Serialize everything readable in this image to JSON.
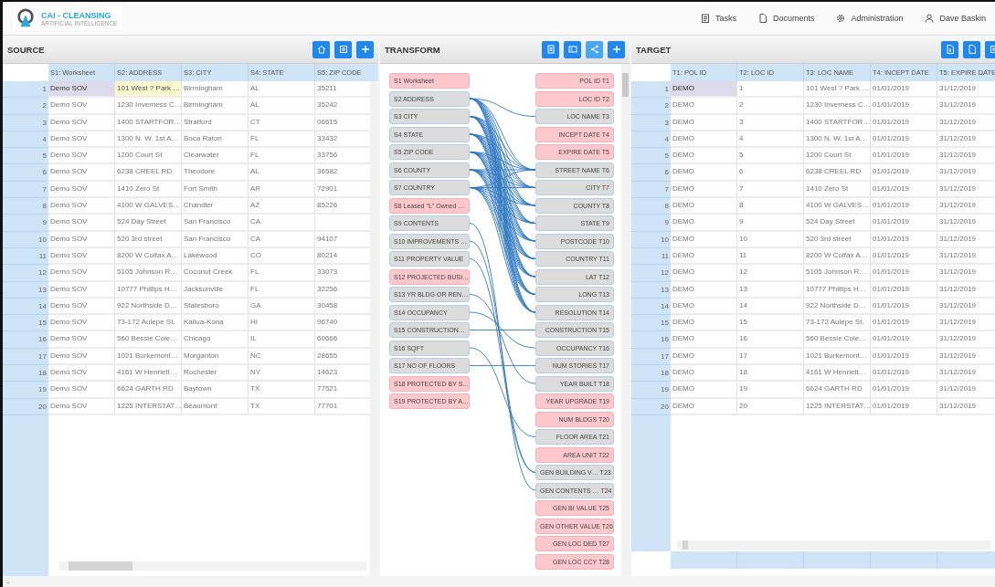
{
  "app": {
    "logo_title": "CAI - CLEANSING",
    "logo_subtitle": "ARTIFICIAL INTELLIGENCE"
  },
  "nav": [
    {
      "label": "Tasks",
      "kind": "tasks"
    },
    {
      "label": "Documents",
      "kind": "documents"
    },
    {
      "label": "Administration",
      "kind": "admin"
    },
    {
      "label": "Dave Baskin",
      "kind": "user"
    }
  ],
  "source": {
    "title": "SOURCE",
    "columns": [
      "S1: Worksheet",
      "S2: ADDRESS",
      "S3: CITY",
      "S4: STATE",
      "S5: ZIP CODE"
    ],
    "rows": [
      {
        "num": "1",
        "cells": [
          "Demo SOV",
          "101 West ? Park …",
          "Birmingham",
          "AL",
          "35211"
        ],
        "selected": true,
        "flagged": true
      },
      {
        "num": "2",
        "cells": [
          "Demo SOV",
          "1230 Inverness C…",
          "Birmingham",
          "AL",
          "35242"
        ],
        "selected": false,
        "flagged": false
      },
      {
        "num": "3",
        "cells": [
          "Demo SOV",
          "1400 STARTFOR…",
          "Stratford",
          "CT",
          "06615"
        ],
        "selected": false,
        "flagged": false
      },
      {
        "num": "4",
        "cells": [
          "Demo SOV",
          "1300 N. W. 1st A…",
          "Boca Raton",
          "FL",
          "33432"
        ],
        "selected": false,
        "flagged": false
      },
      {
        "num": "5",
        "cells": [
          "Demo SOV",
          "1200 Court St",
          "Clearwater",
          "FL",
          "33756"
        ],
        "selected": false,
        "flagged": false
      },
      {
        "num": "6",
        "cells": [
          "Demo SOV",
          "6238 CREEL RD",
          "Theodore",
          "AL",
          "36582"
        ],
        "selected": false,
        "flagged": false
      },
      {
        "num": "7",
        "cells": [
          "Demo SOV",
          "1410 Zero St",
          "Fort Smith",
          "AR",
          "72901"
        ],
        "selected": false,
        "flagged": false
      },
      {
        "num": "8",
        "cells": [
          "Demo SOV",
          "4100 W GALVES…",
          "Chandler",
          "AZ",
          "85226"
        ],
        "selected": false,
        "flagged": false
      },
      {
        "num": "9",
        "cells": [
          "Demo SOV",
          "524 Day Street",
          "San Francisco",
          "CA",
          null
        ],
        "selected": false,
        "flagged": false
      },
      {
        "num": "10",
        "cells": [
          "Demo SOV",
          "520 3rd street",
          "San Francisco",
          "CA",
          "94107"
        ],
        "selected": false,
        "flagged": false
      },
      {
        "num": "11",
        "cells": [
          "Demo SOV",
          "8200 W Colfax A…",
          "Lakewood",
          "CO",
          "80214"
        ],
        "selected": false,
        "flagged": false
      },
      {
        "num": "12",
        "cells": [
          "Demo SOV",
          "5105 Johnson R…",
          "Coconut Creek",
          "FL",
          "33073"
        ],
        "selected": false,
        "flagged": false
      },
      {
        "num": "13",
        "cells": [
          "Demo SOV",
          "10777 Phillips H…",
          "Jacksonville",
          "FL",
          "32256"
        ],
        "selected": false,
        "flagged": false
      },
      {
        "num": "14",
        "cells": [
          "Demo SOV",
          "922 Northside D…",
          "Statesboro",
          "GA",
          "30458"
        ],
        "selected": false,
        "flagged": false
      },
      {
        "num": "15",
        "cells": [
          "Demo SOV",
          "73-172 Aulepe St.",
          "Kailua-Kona",
          "HI",
          "96740"
        ],
        "selected": false,
        "flagged": false
      },
      {
        "num": "16",
        "cells": [
          "Demo SOV",
          "560 Bessie Cole…",
          "Chicago",
          "IL",
          "60666"
        ],
        "selected": false,
        "flagged": false
      },
      {
        "num": "17",
        "cells": [
          "Demo SOV",
          "1021 Burkemont…",
          "Morganton",
          "NC",
          "28655"
        ],
        "selected": false,
        "flagged": false
      },
      {
        "num": "18",
        "cells": [
          "Demo SOV",
          "4161 W Henriett…",
          "Rochester",
          "NY",
          "14623"
        ],
        "selected": false,
        "flagged": false
      },
      {
        "num": "19",
        "cells": [
          "Demo SOV",
          "6624 GARTH RD",
          "Baytown",
          "TX",
          "77521"
        ],
        "selected": false,
        "flagged": false
      },
      {
        "num": "20",
        "cells": [
          "Demo SOV",
          "1225 INTERSTAT…",
          "Beaumont",
          "TX",
          "77701"
        ],
        "selected": false,
        "flagged": false
      }
    ]
  },
  "transform": {
    "title": "TRANSFORM",
    "source_fields": [
      {
        "label": "S1 Worksheet",
        "mapped": false
      },
      {
        "label": "S2 ADDRESS",
        "mapped": true
      },
      {
        "label": "S3 CITY",
        "mapped": true
      },
      {
        "label": "S4 STATE",
        "mapped": true
      },
      {
        "label": "S5 ZIP CODE",
        "mapped": true
      },
      {
        "label": "S6 COUNTY",
        "mapped": true
      },
      {
        "label": "S7 COUNTRY",
        "mapped": true
      },
      {
        "label": "S8 Leased \"L\" Owned …",
        "mapped": false
      },
      {
        "label": "S9 CONTENTS",
        "mapped": true
      },
      {
        "label": "S10 IMPROVEMENTS …",
        "mapped": true
      },
      {
        "label": "S11 PROPERTY VALUE",
        "mapped": true
      },
      {
        "label": "S12 PROJECTED BUSI…",
        "mapped": false
      },
      {
        "label": "S13 YR BLDG OR REN…",
        "mapped": true
      },
      {
        "label": "S14 OCCUPANCY",
        "mapped": true
      },
      {
        "label": "S15 CONSTRUCTION…",
        "mapped": true
      },
      {
        "label": "S16 SQFT",
        "mapped": true
      },
      {
        "label": "S17 NO OF FLOORS",
        "mapped": true
      },
      {
        "label": "S18 PROTECTED BY S…",
        "mapped": false
      },
      {
        "label": "S19 PROTECTED BY A…",
        "mapped": false
      }
    ],
    "target_fields": [
      {
        "label": "POL ID T1",
        "mapped": false
      },
      {
        "label": "LOC ID T2",
        "mapped": false
      },
      {
        "label": "LOC NAME T3",
        "mapped": true
      },
      {
        "label": "INCEPT DATE T4",
        "mapped": false
      },
      {
        "label": "EXPIRE DATE T5",
        "mapped": false
      },
      {
        "label": "STREET NAME T6",
        "mapped": true
      },
      {
        "label": "CITY T7",
        "mapped": true
      },
      {
        "label": "COUNTY T8",
        "mapped": true
      },
      {
        "label": "STATE T9",
        "mapped": true
      },
      {
        "label": "POSTCODE T10",
        "mapped": true
      },
      {
        "label": "COUNTRY T11",
        "mapped": true
      },
      {
        "label": "LAT T12",
        "mapped": true
      },
      {
        "label": "LONG T13",
        "mapped": true
      },
      {
        "label": "RESOLUTION T14",
        "mapped": true
      },
      {
        "label": "CONSTRUCTION T15",
        "mapped": true
      },
      {
        "label": "OCCUPANCY T16",
        "mapped": true
      },
      {
        "label": "NUM STORIES T17",
        "mapped": true
      },
      {
        "label": "YEAR BUILT T18",
        "mapped": true
      },
      {
        "label": "YEAR UPGRADE T19",
        "mapped": false
      },
      {
        "label": "NUM BLDGS T20",
        "mapped": false
      },
      {
        "label": "FLOOR AREA T21",
        "mapped": true
      },
      {
        "label": "AREA UNIT T22",
        "mapped": false
      },
      {
        "label": "GEN BUILDING V… T23",
        "mapped": true
      },
      {
        "label": "GEN CONTENTS … T24",
        "mapped": true
      },
      {
        "label": "GEN BI VALUE T25",
        "mapped": false
      },
      {
        "label": "GEN OTHER VALUE T26",
        "mapped": false
      },
      {
        "label": "GEN LOC DED T27",
        "mapped": false
      },
      {
        "label": "GEN LOC CCY T28",
        "mapped": false
      }
    ]
  },
  "target": {
    "title": "TARGET",
    "columns": [
      "T1: POL ID",
      "T2: LOC ID",
      "T3: LOC NAME",
      "T4: INCEPT DATE",
      "T5: EXPIRE DATE"
    ],
    "rows": [
      {
        "num": "1",
        "cells": [
          "DEMO",
          "1",
          "101 West ? Park …",
          "01/01/2019",
          "31/12/2019"
        ],
        "selected": true
      },
      {
        "num": "2",
        "cells": [
          "DEMO",
          "2",
          "1230 Inverness C…",
          "01/01/2019",
          "31/12/2019"
        ],
        "selected": false
      },
      {
        "num": "3",
        "cells": [
          "DEMO",
          "3",
          "1400 STARTFOR…",
          "01/01/2019",
          "31/12/2019"
        ],
        "selected": false
      },
      {
        "num": "4",
        "cells": [
          "DEMO",
          "4",
          "1300 N. W. 1st A…",
          "01/01/2019",
          "31/12/2019"
        ],
        "selected": false
      },
      {
        "num": "5",
        "cells": [
          "DEMO",
          "5",
          "1200 Court St",
          "01/01/2019",
          "31/12/2019"
        ],
        "selected": false
      },
      {
        "num": "6",
        "cells": [
          "DEMO",
          "6",
          "6238 CREEL RD",
          "01/01/2019",
          "31/12/2019"
        ],
        "selected": false
      },
      {
        "num": "7",
        "cells": [
          "DEMO",
          "7",
          "1410 Zero St",
          "01/01/2019",
          "31/12/2019"
        ],
        "selected": false
      },
      {
        "num": "8",
        "cells": [
          "DEMO",
          "8",
          "4100 W GALVES…",
          "01/01/2019",
          "31/12/2019"
        ],
        "selected": false
      },
      {
        "num": "9",
        "cells": [
          "DEMO",
          "9",
          "524 Day Street",
          "01/01/2019",
          "31/12/2019"
        ],
        "selected": false
      },
      {
        "num": "10",
        "cells": [
          "DEMO",
          "10",
          "520 3rd street",
          "01/01/2019",
          "31/12/2019"
        ],
        "selected": false
      },
      {
        "num": "11",
        "cells": [
          "DEMO",
          "11",
          "8200 W Colfax A…",
          "01/01/2019",
          "31/12/2019"
        ],
        "selected": false
      },
      {
        "num": "12",
        "cells": [
          "DEMO",
          "12",
          "5105 Johnson R…",
          "01/01/2019",
          "31/12/2019"
        ],
        "selected": false
      },
      {
        "num": "13",
        "cells": [
          "DEMO",
          "13",
          "10777 Phillips H…",
          "01/01/2019",
          "31/12/2019"
        ],
        "selected": false
      },
      {
        "num": "14",
        "cells": [
          "DEMO",
          "14",
          "922 Northside D…",
          "01/01/2019",
          "31/12/2019"
        ],
        "selected": false
      },
      {
        "num": "15",
        "cells": [
          "DEMO",
          "15",
          "73-172 Aulepe St.",
          "01/01/2019",
          "31/12/2019"
        ],
        "selected": false
      },
      {
        "num": "16",
        "cells": [
          "DEMO",
          "16",
          "560 Bessie Cole…",
          "01/01/2019",
          "31/12/2019"
        ],
        "selected": false
      },
      {
        "num": "17",
        "cells": [
          "DEMO",
          "17",
          "1021 Burkemont…",
          "01/01/2019",
          "31/12/2019"
        ],
        "selected": false
      },
      {
        "num": "18",
        "cells": [
          "DEMO",
          "18",
          "4161 W Henriett…",
          "01/01/2019",
          "31/12/2019"
        ],
        "selected": false
      },
      {
        "num": "19",
        "cells": [
          "DEMO",
          "19",
          "6624 GARTH RD",
          "01/01/2019",
          "31/12/2019"
        ],
        "selected": false
      },
      {
        "num": "20",
        "cells": [
          "DEMO",
          "20",
          "1225 INTERSTAT…",
          "01/01/2019",
          "31/12/2019"
        ],
        "selected": false
      }
    ]
  },
  "status_bar": "‥"
}
